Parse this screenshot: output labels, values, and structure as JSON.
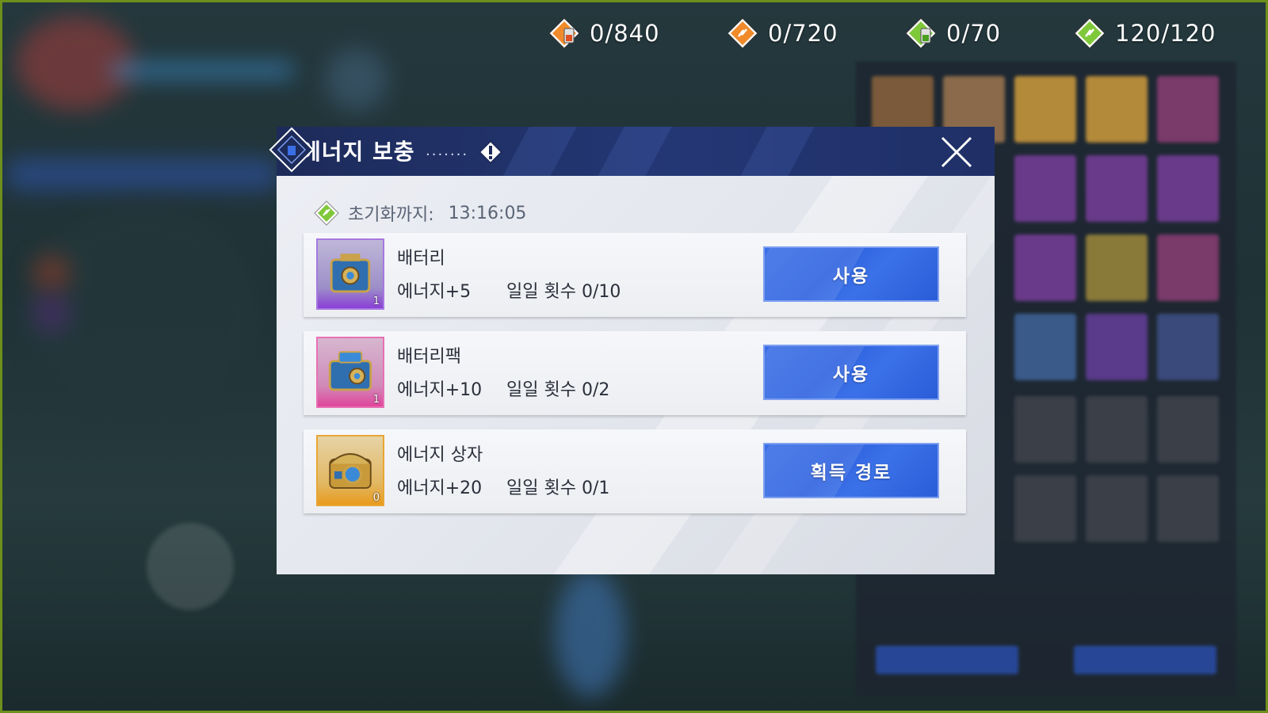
{
  "resources": [
    {
      "icon": "orange-battery-icon",
      "value": "0/840"
    },
    {
      "icon": "orange-energy-ticket-icon",
      "value": "0/720"
    },
    {
      "icon": "green-battery-icon",
      "value": "0/70"
    },
    {
      "icon": "green-energy-ticket-icon",
      "value": "120/120"
    }
  ],
  "dialog": {
    "title": "에너지 보충",
    "title_dots": ".......",
    "reset_label": "초기화까지:",
    "reset_time": "13:16:05",
    "items": [
      {
        "name": "배터리",
        "energy": "에너지+5",
        "limit": "일일 횟수 0/10",
        "qty": "1",
        "rarity": "purple",
        "button": "사용"
      },
      {
        "name": "배터리팩",
        "energy": "에너지+10",
        "limit": "일일 횟수 0/2",
        "qty": "1",
        "rarity": "pink",
        "button": "사용"
      },
      {
        "name": "에너지 상자",
        "energy": "에너지+20",
        "limit": "일일 횟수 0/1",
        "qty": "0",
        "rarity": "gold",
        "button": "획득 경로"
      }
    ]
  },
  "colors": {
    "accent_button": "#2f63e0",
    "header": "#243775",
    "frame": "#6f8f1c"
  }
}
